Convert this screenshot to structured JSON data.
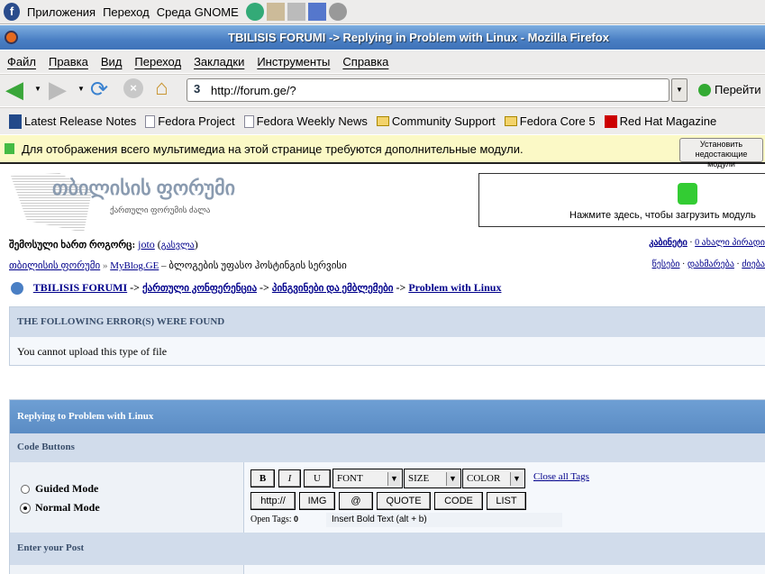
{
  "panel": {
    "items": [
      "Приложения",
      "Переход",
      "Среда GNOME"
    ]
  },
  "window": {
    "title": "TBILISIS FORUMI -> Replying in Problem with Linux - Mozilla Firefox"
  },
  "menu": [
    "Файл",
    "Правка",
    "Вид",
    "Переход",
    "Закладки",
    "Инструменты",
    "Справка"
  ],
  "nav": {
    "url": "http://forum.ge/?",
    "go": "Перейти"
  },
  "bookmarks": [
    "Latest Release Notes",
    "Fedora Project",
    "Fedora Weekly News",
    "Community Support",
    "Fedora Core 5",
    "Red Hat Magazine"
  ],
  "infobar": {
    "text": "Для отображения всего мультимедиа на этой странице требуются дополнительные модули.",
    "button": "Установить недостающие модули"
  },
  "plugin": {
    "text": "Нажмите здесь, чтобы загрузить модуль"
  },
  "logo": {
    "title": "თბილისის ფორუმი",
    "subtitle": "ქართული ფორუმის ძალა"
  },
  "user": {
    "label": "შემოსული ხართ როგორც:",
    "name": "joto",
    "logout": "გასვლა",
    "cabinet": "კაბინეტი",
    "messages": "0 ახალი პირადი"
  },
  "subnav": {
    "home": "თბილისის ფორუმი",
    "sep": "»",
    "blog": "MyBlog.GE",
    "blog_desc": "– ბლოგების უფასო ჰოსტინგის სერვისი",
    "rules": "წესები",
    "help": "დახმარება",
    "search": "ძიება"
  },
  "breadcrumb": [
    "TBILISIS FORUMI",
    "ქართული კონფერენცია",
    "პინგვინები და ემბლემები",
    "Problem with Linux"
  ],
  "error": {
    "title": "THE FOLLOWING ERROR(S) WERE FOUND",
    "message": "You cannot upload this type of file"
  },
  "reply": {
    "title": "Replying to Problem with Linux",
    "code_buttons": "Code Buttons",
    "modes": [
      "Guided Mode",
      "Normal Mode"
    ],
    "selected_mode": "Normal Mode",
    "enter_post": "Enter your Post"
  },
  "editor": {
    "buttons1": [
      "B",
      "I",
      "U"
    ],
    "selects": [
      "FONT",
      "SIZE",
      "COLOR"
    ],
    "close_tags": "Close all Tags",
    "buttons2": [
      "http://",
      "IMG",
      "@",
      "QUOTE",
      "CODE",
      "LIST"
    ],
    "open_tags_label": "Open Tags:",
    "open_tags_count": "0",
    "hint": "Insert Bold Text (alt + b)"
  }
}
